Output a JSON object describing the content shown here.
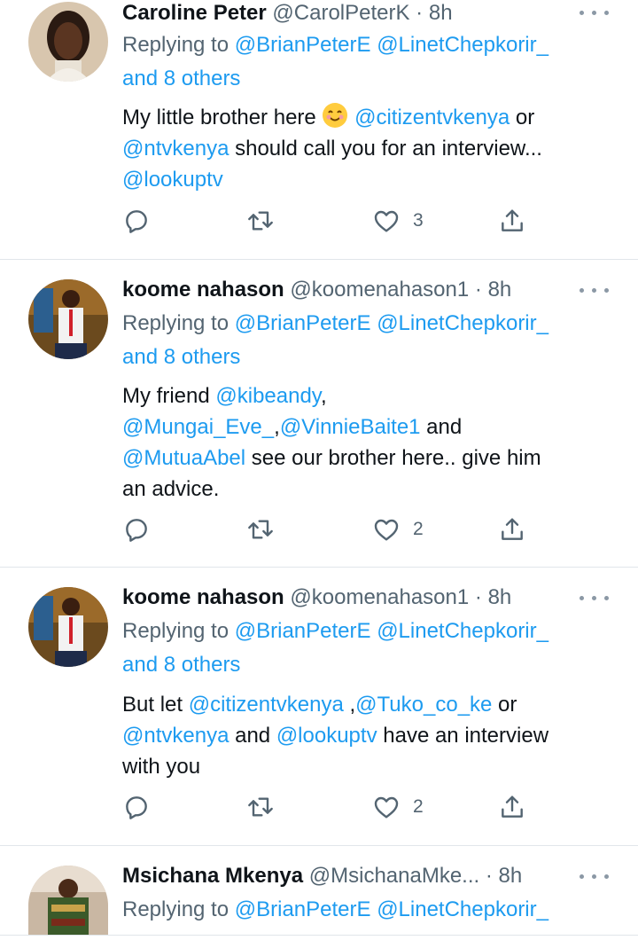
{
  "tweets": [
    {
      "name": "Caroline Peter",
      "handle": "@CarolPeterK",
      "dot": "·",
      "time": "8h",
      "replying_prefix": "Replying to ",
      "reply_to_1": "@BrianPeterE",
      "reply_to_2": "@LinetChepkorir_",
      "reply_others": "and 8 others",
      "text_1": "My little brother here ",
      "emoji": "smiling-face-emoji",
      "mention_1": "@citizentvkenya",
      "text_2": " or",
      "mention_2": "@ntvkenya",
      "text_3": " should call you for an interview...",
      "mention_3": "@lookuptv",
      "like_count": "3"
    },
    {
      "name": "koome nahason",
      "handle": "@koomenahason1",
      "dot": "·",
      "time": "8h",
      "replying_prefix": "Replying to ",
      "reply_to_1": "@BrianPeterE",
      "reply_to_2": "@LinetChepkorir_",
      "reply_others": "and 8 others",
      "text_1": "My friend ",
      "mention_1": "@kibeandy",
      "text_2": ",",
      "mention_2": "@Mungai_Eve_",
      "text_3": ",",
      "mention_3": "@VinnieBaite1",
      "text_4": " and",
      "mention_4": "@MutuaAbel",
      "text_5": " see our brother here.. give him",
      "text_6": "an advice.",
      "like_count": "2"
    },
    {
      "name": "koome nahason",
      "handle": "@koomenahason1",
      "dot": "·",
      "time": "8h",
      "replying_prefix": "Replying to ",
      "reply_to_1": "@BrianPeterE",
      "reply_to_2": "@LinetChepkorir_",
      "reply_others": "and 8 others",
      "text_1": "But let ",
      "mention_1": "@citizentvkenya",
      "text_2": " ,",
      "mention_2": "@Tuko_co_ke",
      "text_3": " or",
      "mention_3": "@ntvkenya",
      "text_4": " and ",
      "mention_4": "@lookuptv",
      "text_5": " have an interview",
      "text_6": "with you",
      "like_count": "2"
    },
    {
      "name": "Msichana Mkenya",
      "handle": "@MsichanaMke...",
      "dot": "·",
      "time": "8h",
      "replying_prefix": "Replying to ",
      "reply_to_1": "@BrianPeterE",
      "reply_to_2": "@LinetChepkorir_"
    }
  ],
  "icons": {
    "reply": "reply-icon",
    "retweet": "retweet-icon",
    "like": "heart-icon",
    "share": "share-icon",
    "more": "more-options-icon"
  },
  "colors": {
    "link": "#1d9bf0",
    "secondary_text": "#536471",
    "primary_text": "#0f1419",
    "divider": "#e1e6ea"
  }
}
